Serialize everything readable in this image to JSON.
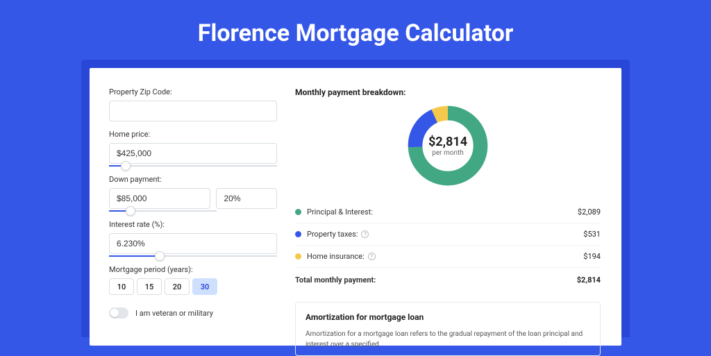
{
  "title": "Florence Mortgage Calculator",
  "form": {
    "zip_label": "Property Zip Code:",
    "zip_value": "",
    "price_label": "Home price:",
    "price_value": "$425,000",
    "price_slider_pct": 10,
    "down_label": "Down payment:",
    "down_value": "$85,000",
    "down_pct_value": "20%",
    "down_slider_pct": 20,
    "rate_label": "Interest rate (%):",
    "rate_value": "6.230%",
    "rate_slider_pct": 30,
    "period_label": "Mortgage period (years):",
    "periods": [
      "10",
      "15",
      "20",
      "30"
    ],
    "period_active": "30",
    "veteran_label": "I am veteran or military"
  },
  "breakdown": {
    "title": "Monthly payment breakdown:",
    "center_amount": "$2,814",
    "center_sub": "per month",
    "items": [
      {
        "label": "Principal & Interest:",
        "value": "$2,089",
        "color": "#41a883",
        "info": false
      },
      {
        "label": "Property taxes:",
        "value": "$531",
        "color": "#3557e8",
        "info": true
      },
      {
        "label": "Home insurance:",
        "value": "$194",
        "color": "#f4c94b",
        "info": true
      }
    ],
    "total_label": "Total monthly payment:",
    "total_value": "$2,814"
  },
  "chart_data": {
    "type": "pie",
    "title": "Monthly payment breakdown",
    "slices": [
      {
        "name": "Principal & Interest",
        "value": 2089,
        "color": "#41a883"
      },
      {
        "name": "Property taxes",
        "value": 531,
        "color": "#3557e8"
      },
      {
        "name": "Home insurance",
        "value": 194,
        "color": "#f4c94b"
      }
    ],
    "total": 2814,
    "center_label": "$2,814",
    "center_sub": "per month"
  },
  "amort": {
    "title": "Amortization for mortgage loan",
    "text": "Amortization for a mortgage loan refers to the gradual repayment of the loan principal and interest over a specified"
  }
}
